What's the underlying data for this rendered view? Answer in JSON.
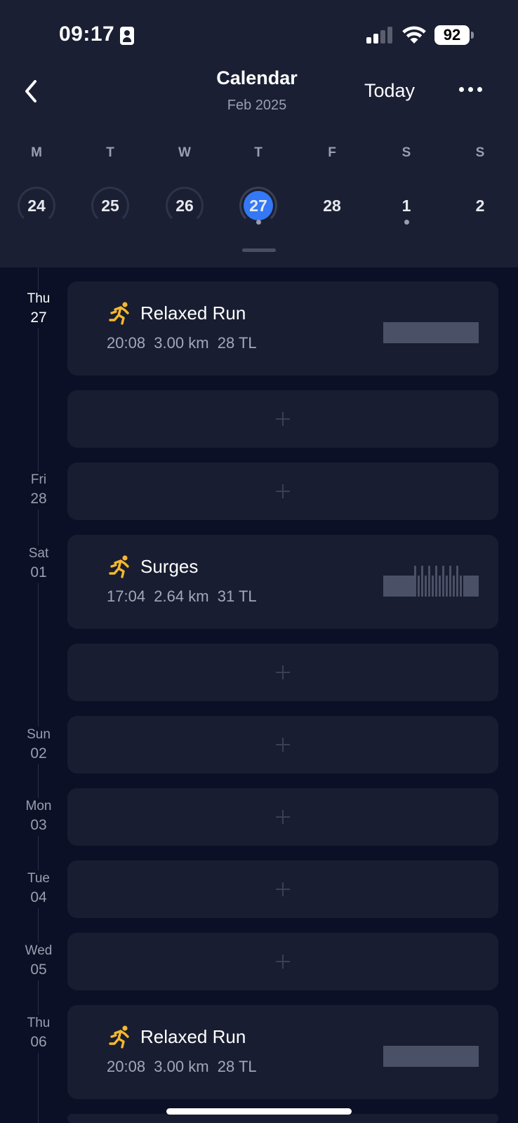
{
  "status_bar": {
    "time": "09:17",
    "battery": "92"
  },
  "header": {
    "title": "Calendar",
    "subtitle": "Feb 2025",
    "today_label": "Today"
  },
  "week": {
    "weekdays": [
      "M",
      "T",
      "W",
      "T",
      "F",
      "S",
      "S"
    ],
    "days": [
      "24",
      "25",
      "26",
      "27",
      "28",
      "1",
      "2"
    ],
    "selected": "27"
  },
  "timeline": [
    {
      "weekday": "Thu",
      "date": "27"
    },
    {
      "weekday": "Fri",
      "date": "28"
    },
    {
      "weekday": "Sat",
      "date": "01"
    },
    {
      "weekday": "Sun",
      "date": "02"
    },
    {
      "weekday": "Mon",
      "date": "03"
    },
    {
      "weekday": "Tue",
      "date": "04"
    },
    {
      "weekday": "Wed",
      "date": "05"
    },
    {
      "weekday": "Thu",
      "date": "06"
    }
  ],
  "workouts": [
    {
      "title": "Relaxed Run",
      "time": "20:08",
      "distance": "3.00 km",
      "load": "28 TL"
    },
    {
      "title": "Surges",
      "time": "17:04",
      "distance": "2.64 km",
      "load": "31 TL"
    },
    {
      "title": "Relaxed Run",
      "time": "20:08",
      "distance": "3.00 km",
      "load": "28 TL"
    }
  ],
  "colors": {
    "accent": "#3478f6",
    "run_icon": "#f5b82e",
    "background": "#0b1026",
    "card": "#181d31",
    "header": "#1a1f33"
  }
}
